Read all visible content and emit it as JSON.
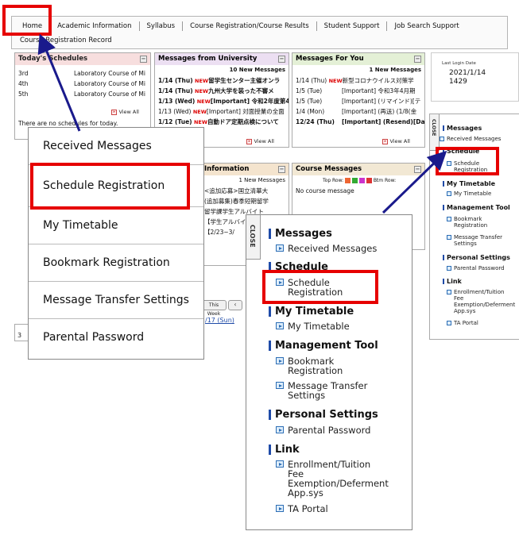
{
  "nav": {
    "items": [
      "Home",
      "Academic Information",
      "Syllabus",
      "Course Registration/Course Results",
      "Student Support",
      "Job Search Support"
    ],
    "second_row": "Course Registration Record"
  },
  "today": {
    "title": "Today's Schedules",
    "rows": [
      {
        "period": "3rd",
        "course": "Laboratory Course of Mi"
      },
      {
        "period": "4th",
        "course": "Laboratory Course of Mi"
      },
      {
        "period": "5th",
        "course": "Laboratory Course of Mi"
      }
    ],
    "view_all": "View All",
    "empty": "There are no schedules for today."
  },
  "univ": {
    "title": "Messages from University",
    "count": "10 New Messages",
    "rows": [
      {
        "date": "1/14 (Thu)",
        "new": "NEW",
        "text": "留学生センター主催オンラ"
      },
      {
        "date": "1/14 (Thu)",
        "new": "NEW",
        "text": "九州大学を装った不審メ"
      },
      {
        "date": "1/13 (Wed)",
        "new": "NEW",
        "text": "[Important] 令和2年度第4"
      },
      {
        "date": "1/13 (Wed)",
        "new": "NEW",
        "text": "[Important] 対面授業の全面"
      },
      {
        "date": "1/12 (Tue)",
        "new": "NEW",
        "text": "自動ドア定期点検について"
      }
    ],
    "view_all": "View All"
  },
  "foryou": {
    "title": "Messages For You",
    "count": "1 New Messages",
    "rows": [
      {
        "date": "1/14 (Thu)",
        "new": "NEW",
        "text": "新型コロナウイルス対策学"
      },
      {
        "date": "1/5 (Tue)",
        "new": "",
        "text": "[Important] 令和3年4月期"
      },
      {
        "date": "1/5 (Tue)",
        "new": "",
        "text": "[Important] (リマインド)[テ"
      },
      {
        "date": "1/4 (Mon)",
        "new": "",
        "text": "[Important] (再送) (1/8(金"
      },
      {
        "date": "12/24 (Thu)",
        "new": "",
        "text": "[Important] (Resend)[Dat"
      }
    ],
    "view_all": "View All"
  },
  "login": {
    "label": "Last Login Date",
    "date": "2021/1/14",
    "time": "1429"
  },
  "info": {
    "title": "Information",
    "count": "1 New Messages",
    "rows": [
      "<追加応募>国立清華大",
      "(追加募集)春季短期留学",
      "留学課学生アルバイト",
      "【学生アルバイト】",
      "【2/23~3/"
    ]
  },
  "course_msgs": {
    "title": "Course Messages",
    "top_row": "Top Row:",
    "btm_row": "Btm Row:",
    "empty": "No course message"
  },
  "calendar": {
    "this_week": "This Week",
    "date": "/17 (Sun)"
  },
  "menu": {
    "items": [
      "Received Messages",
      "Schedule Registration",
      "My Timetable",
      "Bookmark Registration",
      "Message Transfer Settings",
      "Parental Password"
    ]
  },
  "popup": {
    "close": "CLOSE",
    "messages": "Messages",
    "received": "Received Messages",
    "schedule": "Schedule",
    "schedule_reg_1": "Schedule",
    "schedule_reg_2": "Registration",
    "my_timetable": "My Timetable",
    "my_timetable_link": "My Timetable",
    "mgmt": "Management Tool",
    "bookmark_1": "Bookmark",
    "bookmark_2": "Registration",
    "transfer_1": "Message Transfer",
    "transfer_2": "Settings",
    "personal": "Personal Settings",
    "parental": "Parental Password",
    "link": "Link",
    "enroll_1": "Enrollment/Tuition",
    "enroll_2": "Fee",
    "enroll_3": "Exemption/Deferment",
    "enroll_4": "App.sys",
    "ta": "TA Portal"
  },
  "side": {
    "close": "CLOSE",
    "messages": "Messages",
    "received": "Received Messages",
    "schedule": "Schedule",
    "schedule_reg_1": "Schedule",
    "schedule_reg_2": "Registration",
    "my_timetable": "My Timetable",
    "my_timetable_link": "My Timetable",
    "mgmt": "Management Tool",
    "bookmark_1": "Bookmark",
    "bookmark_2": "Registration",
    "transfer_1": "Message Transfer",
    "transfer_2": "Settings",
    "personal": "Personal Settings",
    "parental": "Parental Password",
    "link": "Link",
    "enroll_1": "Enrollment/Tuition",
    "enroll_2": "Fee",
    "enroll_3": "Exemption/Deferment",
    "enroll_4": "App.sys",
    "ta": "TA Portal"
  },
  "stray": {
    "digit": "3"
  },
  "colors": {
    "highlight": "#e60000",
    "arrow": "#1a1a8c",
    "today_bg": "#f7dede",
    "univ_bg": "#ecdff2",
    "foryou_bg": "#e4f0d6",
    "info_bg": "#f4e4ce",
    "course_bg": "#f2e8d4"
  }
}
